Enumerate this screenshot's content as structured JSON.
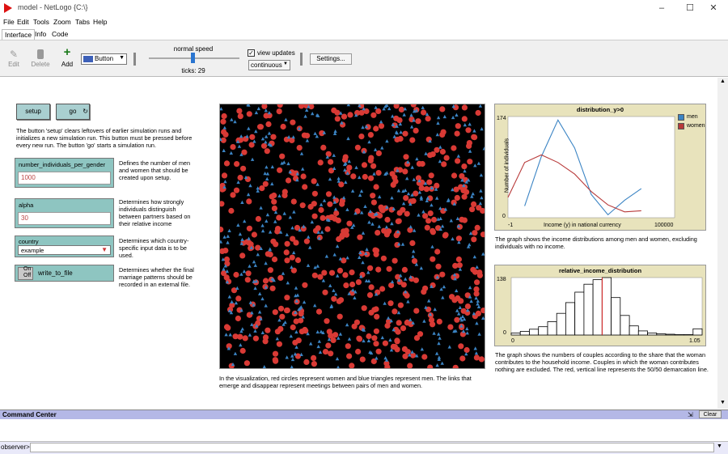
{
  "window": {
    "title": "model - NetLogo {C:\\}"
  },
  "menus": [
    "File",
    "Edit",
    "Tools",
    "Zoom",
    "Tabs",
    "Help"
  ],
  "tabs": [
    "Interface",
    "Info",
    "Code"
  ],
  "toolbar": {
    "edit": "Edit",
    "delete": "Delete",
    "add": "Add",
    "widget_type": "Button",
    "speed_label": "normal speed",
    "ticks_label": "ticks: 29",
    "view_updates_label": "view updates",
    "view_updates_checked": true,
    "update_mode": "continuous",
    "settings": "Settings..."
  },
  "widgets": {
    "setup": "setup",
    "go": "go",
    "setup_desc": "The button 'setup' clears leftovers of earlier simulation runs and initializes a new simulation run. This button must be pressed before every new run. The button 'go' starts a simulation run.",
    "number_individuals": {
      "label": "number_individuals_per_gender",
      "value": "1000",
      "desc": "Defines the number of men and women that should be created upon setup."
    },
    "alpha": {
      "label": "alpha",
      "value": "30",
      "desc": "Determines how strongly individuals distinguish between partners based on their relative income"
    },
    "country": {
      "label": "country",
      "value": "example",
      "desc": "Determines which country-specific input data is to be used."
    },
    "write_to_file": {
      "on": "On",
      "off": "Off",
      "label": "write_to_file",
      "desc": "Determines whether the final marriage patterns should be recorded in an external file."
    }
  },
  "view_caption": "In the visualization, red circles represent women and blue triangles represent men. The links that emerge and disappear represent meetings between pairs of men and women.",
  "plot1": {
    "title": "distribution_y>0",
    "ylabel": "Number of individuals",
    "xlabel": "Income (y) in national currency",
    "ymax": "174",
    "ymin": "0",
    "xmin": "-1",
    "xmax": "100000",
    "legend": [
      {
        "name": "men",
        "color": "#3b84c4"
      },
      {
        "name": "women",
        "color": "#b83a3a"
      }
    ],
    "caption": "The graph shows the income distributions among men and women, excluding individuals with no income."
  },
  "plot2": {
    "title": "relative_income_distribution",
    "ymax": "138",
    "ymin": "0",
    "xmin": "0",
    "xmax": "1.05",
    "caption": "The graph shows the numbers of couples according to the share that the woman contributes to the household income. Couples in which the woman contributes nothing are excluded. The red, vertical line represents the 50/50 demarcation line."
  },
  "command_center": {
    "title": "Command Center",
    "clear": "Clear",
    "prompt": "observer>"
  },
  "chart_data": [
    {
      "type": "line",
      "title": "distribution_y>0",
      "xlabel": "Income (y) in national currency",
      "ylabel": "Number of individuals",
      "xlim": [
        -1,
        100000
      ],
      "ylim": [
        0,
        174
      ],
      "x": [
        0,
        10000,
        20000,
        30000,
        40000,
        50000,
        60000,
        70000,
        80000
      ],
      "series": [
        {
          "name": "men",
          "color": "#3b84c4",
          "values": [
            null,
            20,
            105,
            168,
            120,
            40,
            5,
            30,
            50
          ]
        },
        {
          "name": "women",
          "color": "#b83a3a",
          "values": [
            35,
            95,
            108,
            95,
            75,
            45,
            22,
            10,
            12
          ]
        }
      ],
      "legend": "right"
    },
    {
      "type": "bar",
      "title": "relative_income_distribution",
      "xlim": [
        0,
        1.05
      ],
      "ylim": [
        0,
        138
      ],
      "categories": [
        "0.00",
        "0.05",
        "0.10",
        "0.15",
        "0.20",
        "0.25",
        "0.30",
        "0.35",
        "0.40",
        "0.45",
        "0.50",
        "0.55",
        "0.60",
        "0.65",
        "0.70",
        "0.75",
        "0.80",
        "0.85",
        "0.90",
        "0.95",
        "1.00"
      ],
      "values": [
        5,
        9,
        14,
        20,
        32,
        52,
        78,
        103,
        122,
        133,
        138,
        90,
        47,
        22,
        10,
        5,
        3,
        2,
        1,
        1,
        15
      ],
      "marker_line": 0.5
    }
  ],
  "colors": {
    "men": "#3b84c4",
    "women": "#d93a35",
    "view_bg": "#000000",
    "widget": "#8ec5c1",
    "plot_bg": "#e8e3bc"
  }
}
